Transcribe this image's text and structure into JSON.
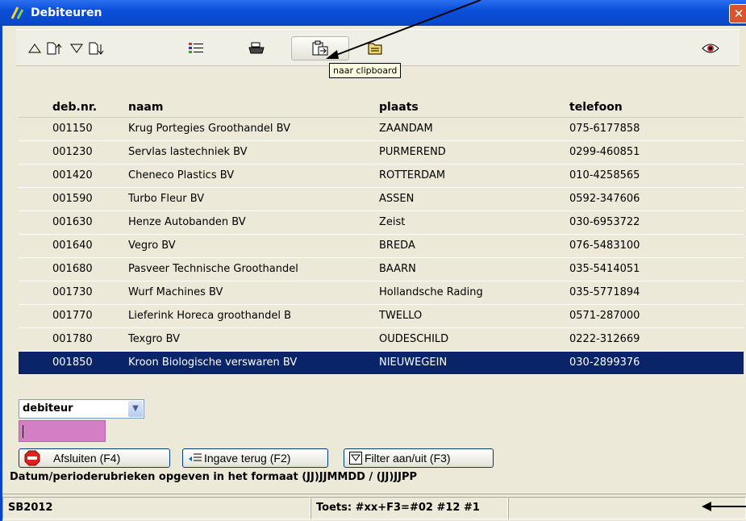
{
  "window": {
    "title": "Debiteuren",
    "close_glyph": "✕"
  },
  "toolbar": {
    "buttons": [
      {
        "icon": "sort-ascending-icon"
      },
      {
        "icon": "sort-up-document-icon"
      },
      {
        "icon": "sort-descending-icon"
      },
      {
        "icon": "sort-down-document-icon"
      },
      {
        "icon": "list-options-icon"
      },
      {
        "icon": "printer-icon"
      },
      {
        "icon": "clipboard-icon",
        "pressed": true
      },
      {
        "icon": "export-folder-icon"
      },
      {
        "icon": "eye-icon"
      }
    ],
    "tooltip": "naar clipboard"
  },
  "grid": {
    "columns": [
      "deb.nr.",
      "naam",
      "plaats",
      "telefoon"
    ],
    "rows": [
      [
        "001150",
        "Krug Portegies Groothandel BV",
        "ZAANDAM",
        "075-6177858"
      ],
      [
        "001230",
        "Servlas lastechniek BV",
        "PURMEREND",
        "0299-460851"
      ],
      [
        "001420",
        "Cheneco Plastics BV",
        "ROTTERDAM",
        "010-4258565"
      ],
      [
        "001590",
        "Turbo Fleur BV",
        "ASSEN",
        "0592-347606"
      ],
      [
        "001630",
        "Henze Autobanden BV",
        "Zeist",
        "030-6953722"
      ],
      [
        "001640",
        "Vegro BV",
        "BREDA",
        "076-5483100"
      ],
      [
        "001680",
        "Pasveer Technische Groothandel",
        "BAARN",
        "035-5414051"
      ],
      [
        "001730",
        "Wurf Machines BV",
        "Hollandsche Rading",
        "035-5771894"
      ],
      [
        "001770",
        "Lieferink Horeca groothandel B",
        "TWELLO",
        "0571-287000"
      ],
      [
        "001780",
        "Texgro BV",
        "OUDESCHILD",
        "0222-312669"
      ],
      [
        "001850",
        "Kroon Biologische verswaren BV",
        "NIEUWEGEIN",
        "030-2899376"
      ]
    ],
    "selected_index": 10
  },
  "search": {
    "field_select": "debiteur",
    "value": ""
  },
  "buttons": {
    "close_label": "Afsluiten (F4)",
    "back_label": "Ingave terug (F2)",
    "filter_label": "Filter aan/uit (F3)"
  },
  "hint": "Datum/perioderubrieken opgeven in het formaat (JJ)JJMMDD / (JJ)JJPP",
  "status": {
    "left": "SB2012",
    "middle": "Toets: #xx+F3=#02 #12 #1",
    "right": ""
  },
  "colors": {
    "selection": "#0a246a",
    "title_bar": "#0a4fd8",
    "search_input": "#d47fc5"
  }
}
